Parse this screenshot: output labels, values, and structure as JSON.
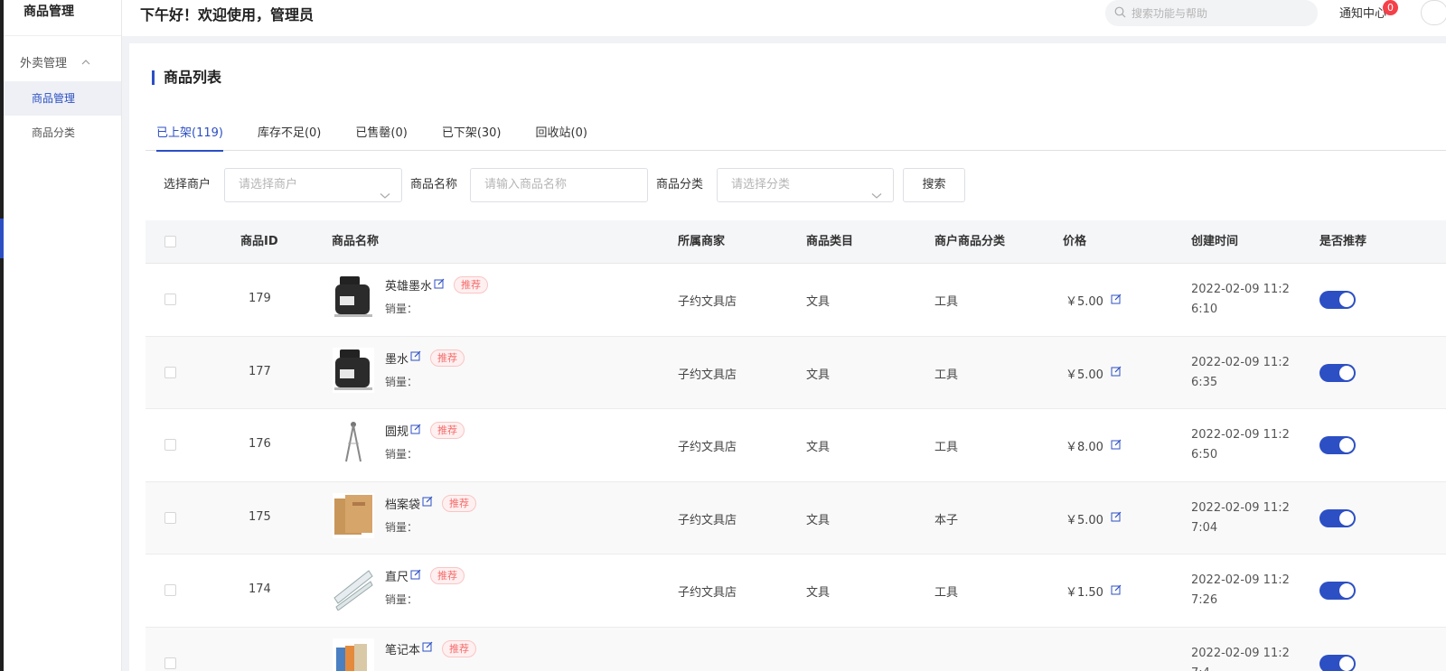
{
  "sidebar": {
    "title": "商品管理",
    "group_label": "外卖管理",
    "items": [
      {
        "label": "商品管理",
        "active": true
      },
      {
        "label": "商品分类",
        "active": false
      }
    ]
  },
  "header": {
    "greeting": "下午好！欢迎使用，管理员",
    "search_placeholder": "搜索功能与帮助",
    "notify_label": "通知中心",
    "notify_count": "0"
  },
  "page": {
    "title": "商品列表",
    "tabs": [
      "已上架(119)",
      "库存不足(0)",
      "已售罄(0)",
      "已下架(30)",
      "回收站(0)"
    ],
    "active_tab": 0
  },
  "filters": {
    "merchant_label": "选择商户",
    "merchant_placeholder": "请选择商户",
    "name_label": "商品名称",
    "name_placeholder": "请输入商品名称",
    "category_label": "商品分类",
    "category_placeholder": "请选择分类",
    "search_button": "搜索"
  },
  "table": {
    "headers": [
      "商品ID",
      "商品名称",
      "所属商家",
      "商品类目",
      "商户商品分类",
      "价格",
      "创建时间",
      "是否推荐"
    ],
    "sales_label": "销量：",
    "recommend_tag": "推荐",
    "rows": [
      {
        "id": "179",
        "name": "英雄墨水",
        "merchant": "子约文具店",
        "category": "文具",
        "merchant_category": "工具",
        "price": "￥5.00",
        "created": "2022-02-09 11:26:10",
        "recommended": true,
        "image": "ink-bottle"
      },
      {
        "id": "177",
        "name": "墨水",
        "merchant": "子约文具店",
        "category": "文具",
        "merchant_category": "工具",
        "price": "￥5.00",
        "created": "2022-02-09 11:26:35",
        "recommended": true,
        "image": "ink-bottle"
      },
      {
        "id": "176",
        "name": "圆规",
        "merchant": "子约文具店",
        "category": "文具",
        "merchant_category": "工具",
        "price": "￥8.00",
        "created": "2022-02-09 11:26:50",
        "recommended": true,
        "image": "compass"
      },
      {
        "id": "175",
        "name": "档案袋",
        "merchant": "子约文具店",
        "category": "文具",
        "merchant_category": "本子",
        "price": "￥5.00",
        "created": "2022-02-09 11:27:04",
        "recommended": true,
        "image": "folder"
      },
      {
        "id": "174",
        "name": "直尺",
        "merchant": "子约文具店",
        "category": "文具",
        "merchant_category": "工具",
        "price": "￥1.50",
        "created": "2022-02-09 11:27:26",
        "recommended": true,
        "image": "ruler"
      },
      {
        "id": "",
        "name": "笔记本",
        "merchant": "",
        "category": "",
        "merchant_category": "",
        "price": "",
        "created": "2022-02-09 11:27:4",
        "recommended": true,
        "image": "notebook"
      }
    ]
  },
  "colors": {
    "accent": "#2c4fc4",
    "tag_red": "#f56c6c",
    "badge": "#f5404a"
  }
}
